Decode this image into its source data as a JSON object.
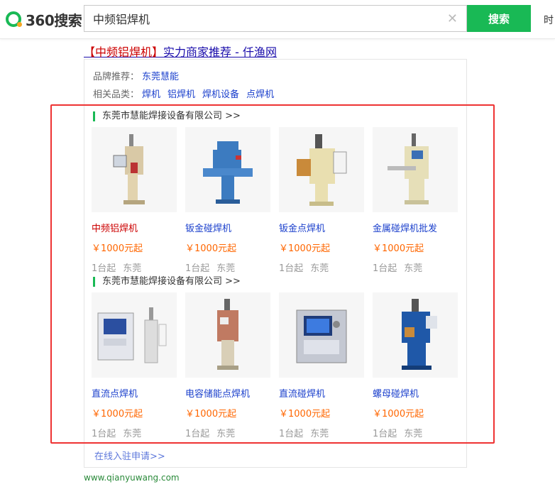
{
  "header": {
    "logo_text": "360搜索",
    "search_value": "中频铝焊机",
    "search_button": "搜索",
    "right_link": "时"
  },
  "result": {
    "title_bracket_open": "【",
    "title_highlight": "中频铝焊机",
    "title_bracket_close": "】",
    "title_rest": "实力商家推荐 - 仟渔网",
    "brand_label": "品牌推荐：",
    "brand_value": "东莞慧能",
    "category_label": "相关品类：",
    "categories": [
      "焊机",
      "铝焊机",
      "焊机设备",
      "点焊机"
    ],
    "groups": [
      {
        "company": "东莞市慧能焊接设备有限公司 >>",
        "products": [
          {
            "name": "中频铝焊机",
            "price": "￥1000元起",
            "moq": "1台起",
            "city": "东莞",
            "img_color": "#d9c9a6"
          },
          {
            "name": "钣金碰焊机",
            "price": "￥1000元起",
            "moq": "1台起",
            "city": "东莞",
            "img_color": "#3c7bc0"
          },
          {
            "name": "钣金点焊机",
            "price": "￥1000元起",
            "moq": "1台起",
            "city": "东莞",
            "img_color": "#e9dfb0"
          },
          {
            "name": "金属碰焊机批发",
            "price": "￥1000元起",
            "moq": "1台起",
            "city": "东莞",
            "img_color": "#e6dfb8"
          }
        ]
      },
      {
        "company": "东莞市慧能焊接设备有限公司 >>",
        "products": [
          {
            "name": "直流点焊机",
            "price": "￥1000元起",
            "moq": "1台起",
            "city": "东莞",
            "img_color": "#c9ccd6"
          },
          {
            "name": "电容储能点焊机",
            "price": "￥1000元起",
            "moq": "1台起",
            "city": "东莞",
            "img_color": "#c07a62"
          },
          {
            "name": "直流碰焊机",
            "price": "￥1000元起",
            "moq": "1台起",
            "city": "东莞",
            "img_color": "#c4c8d2"
          },
          {
            "name": "螺母碰焊机",
            "price": "￥1000元起",
            "moq": "1台起",
            "city": "东莞",
            "img_color": "#1f58a8"
          }
        ]
      }
    ],
    "apply_link": "在线入驻申请>>",
    "site_url": "www.qianyuwang.com"
  },
  "colors": {
    "accent_green": "#19b955",
    "link_blue": "#1a3fcc",
    "price_orange": "#f60",
    "highlight_red": "#c00",
    "frame_red": "#e33"
  }
}
